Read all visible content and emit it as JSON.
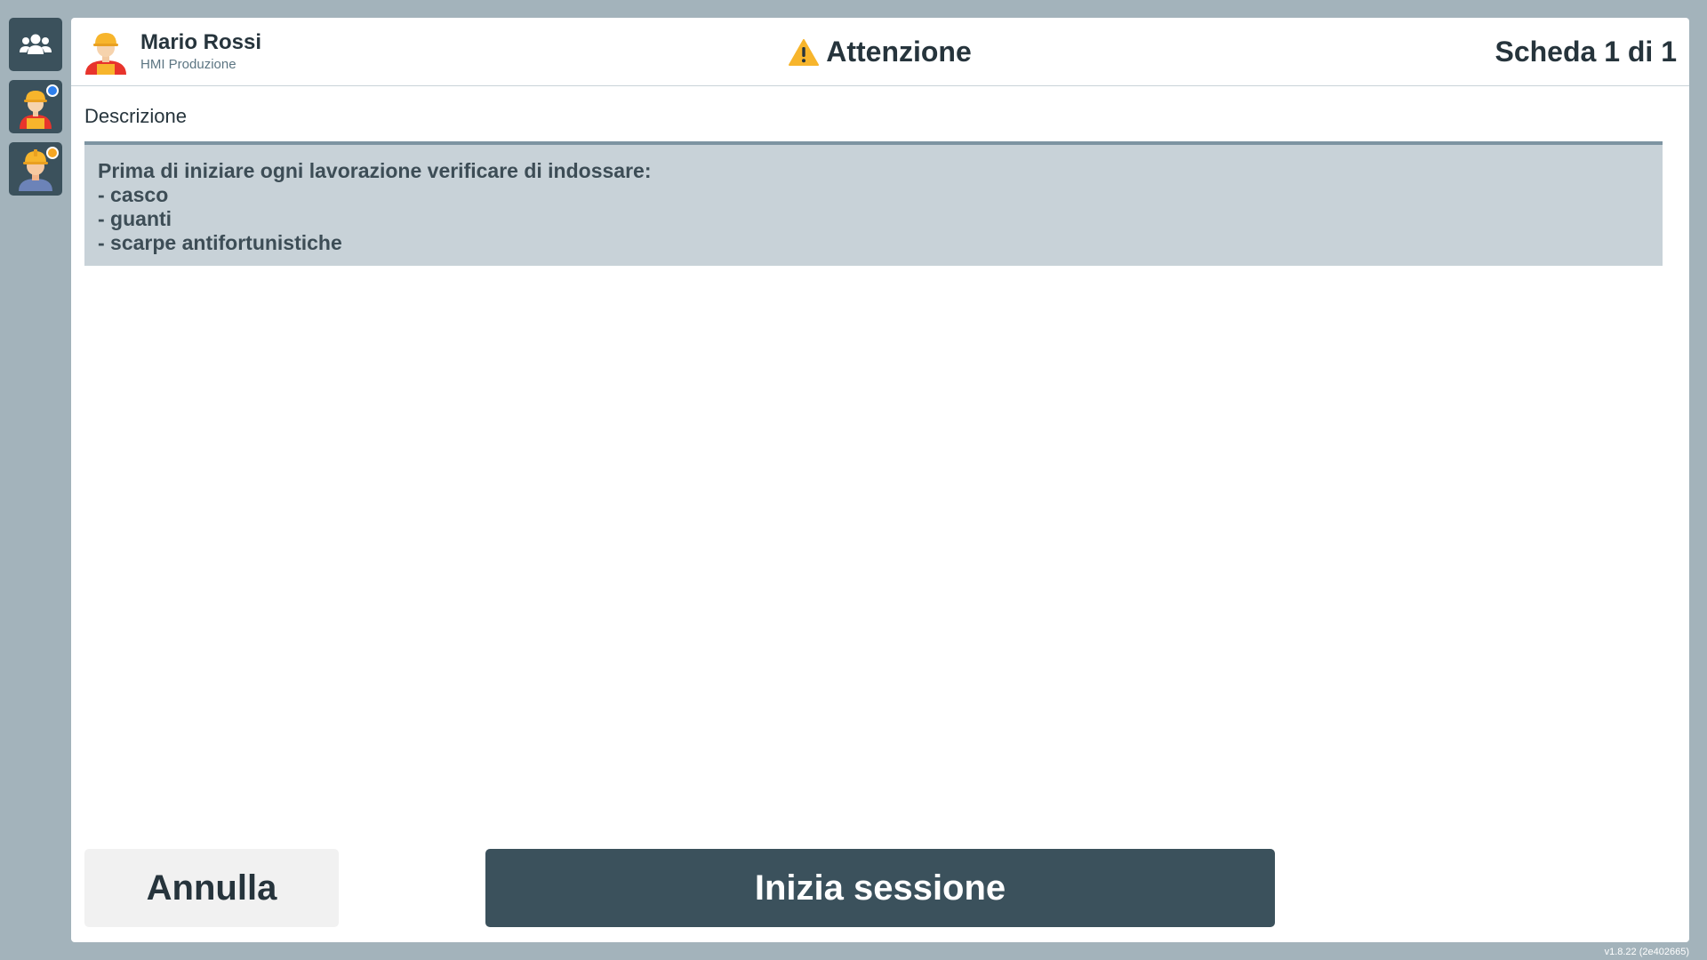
{
  "sidebar": {
    "items": [
      {
        "icon": "users-group-icon"
      },
      {
        "icon": "worker-avatar-icon",
        "badge_color": "#2f80ed"
      },
      {
        "icon": "worker-helmet-icon",
        "badge_color": "#f5a623"
      }
    ]
  },
  "header": {
    "user_name": "Mario Rossi",
    "user_role": "HMI Produzione",
    "title": "Attenzione",
    "title_icon": "warning-icon",
    "page_count": "Scheda 1 di 1"
  },
  "content": {
    "section_label": "Descrizione",
    "description_lines": [
      "Prima di iniziare ogni lavorazione verificare di indossare:",
      "- casco",
      "- guanti",
      "- scarpe antifortunistiche"
    ]
  },
  "actions": {
    "cancel_label": "Annulla",
    "start_label": "Inizia sessione"
  },
  "footer": {
    "version": "v1.8.22 (2e402665)"
  },
  "colors": {
    "background": "#a3b3bb",
    "sidebar_button": "#3b515c",
    "primary_button": "#3b515c",
    "description_bg": "#c8d2d8",
    "warning": "#f7b52c"
  }
}
